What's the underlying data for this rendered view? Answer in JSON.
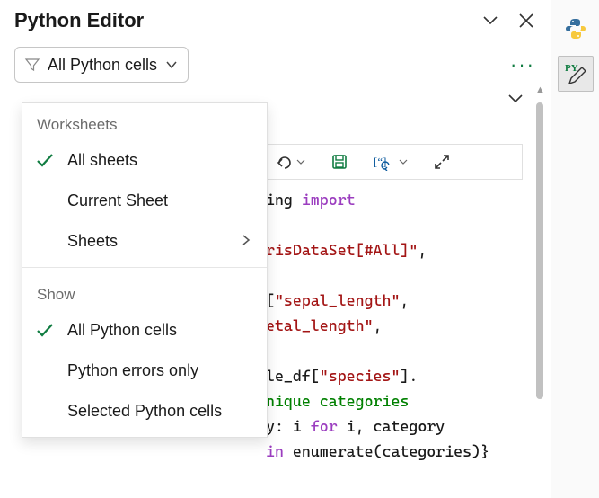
{
  "header": {
    "title": "Python Editor"
  },
  "filter": {
    "label": "All Python cells"
  },
  "dropdown": {
    "section_worksheets": "Worksheets",
    "item_all_sheets": "All sheets",
    "item_current_sheet": "Current Sheet",
    "item_sheets": "Sheets",
    "section_show": "Show",
    "item_all_python_cells": "All Python cells",
    "item_errors_only": "Python errors only",
    "item_selected_cells": "Selected Python cells"
  },
  "rail": {
    "py_badge": "PY"
  },
  "code": {
    "l1_a": "ing ",
    "l1_b": "import",
    "l2": "",
    "l3_a": "risDataSet[#All]\"",
    "l3_b": ",",
    "l4": "",
    "l5_a": "[",
    "l5_b": "\"sepal_length\"",
    "l5_c": ",",
    "l6_a": "etal_length\"",
    "l6_b": ",",
    "l7": "",
    "l8_a": "le_df[",
    "l8_b": "\"species\"",
    "l8_c": "].",
    "l9": "nique categories",
    "l10_a": "y: i ",
    "l10_b": "for",
    "l10_c": " i, category",
    "l11_a": "in",
    "l11_b": " enumerate(categories)}"
  }
}
